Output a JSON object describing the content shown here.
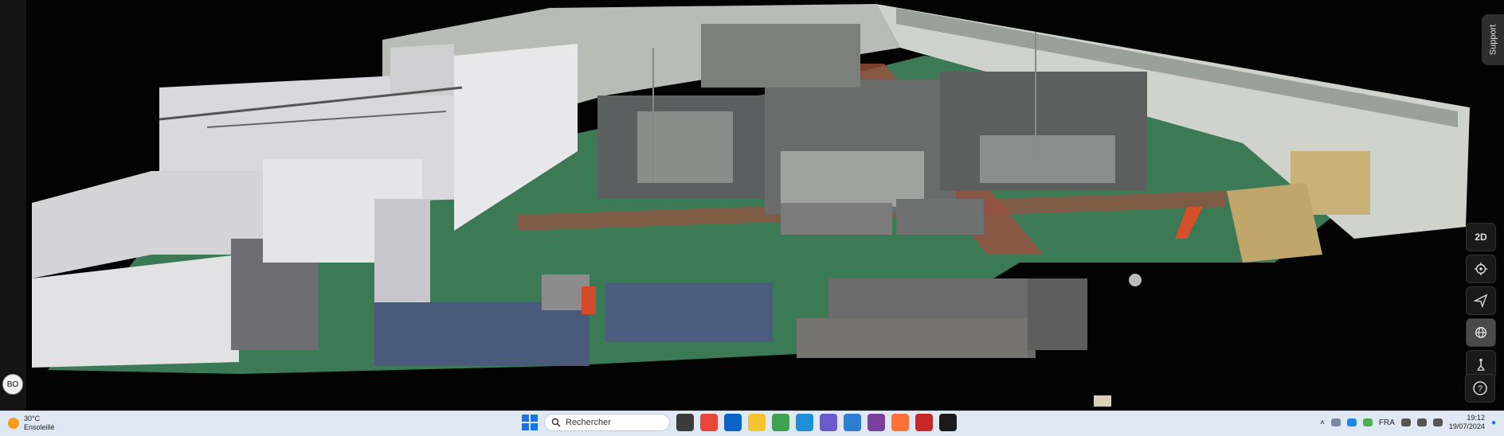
{
  "viewer": {
    "support_label": "Support",
    "tool_2d_label": "2D",
    "avatar_initials": "BO",
    "tools": [
      "locate-icon",
      "send-icon",
      "globe-icon",
      "walk-icon"
    ],
    "help_icon": "help-icon"
  },
  "taskbar": {
    "weather_temp": "30°C",
    "weather_desc": "Ensoleillé",
    "search_placeholder": "Rechercher",
    "apps": [
      {
        "name": "task-view",
        "color": "#3b3b3b"
      },
      {
        "name": "chrome",
        "color": "#e8453c"
      },
      {
        "name": "outlook",
        "color": "#0a64c8"
      },
      {
        "name": "file-explorer",
        "color": "#f4c430"
      },
      {
        "name": "app-green",
        "color": "#3fa34d"
      },
      {
        "name": "edge",
        "color": "#1e8fd6"
      },
      {
        "name": "copilot",
        "color": "#6a5acd"
      },
      {
        "name": "store",
        "color": "#2d7dd2"
      },
      {
        "name": "app-purple",
        "color": "#7b3fa0"
      },
      {
        "name": "firefox",
        "color": "#ff7139"
      },
      {
        "name": "app-red",
        "color": "#c62828"
      },
      {
        "name": "app-dark",
        "color": "#1b1b1b"
      }
    ],
    "language": "FRA",
    "time": "19:12",
    "date": "19/07/2024"
  }
}
